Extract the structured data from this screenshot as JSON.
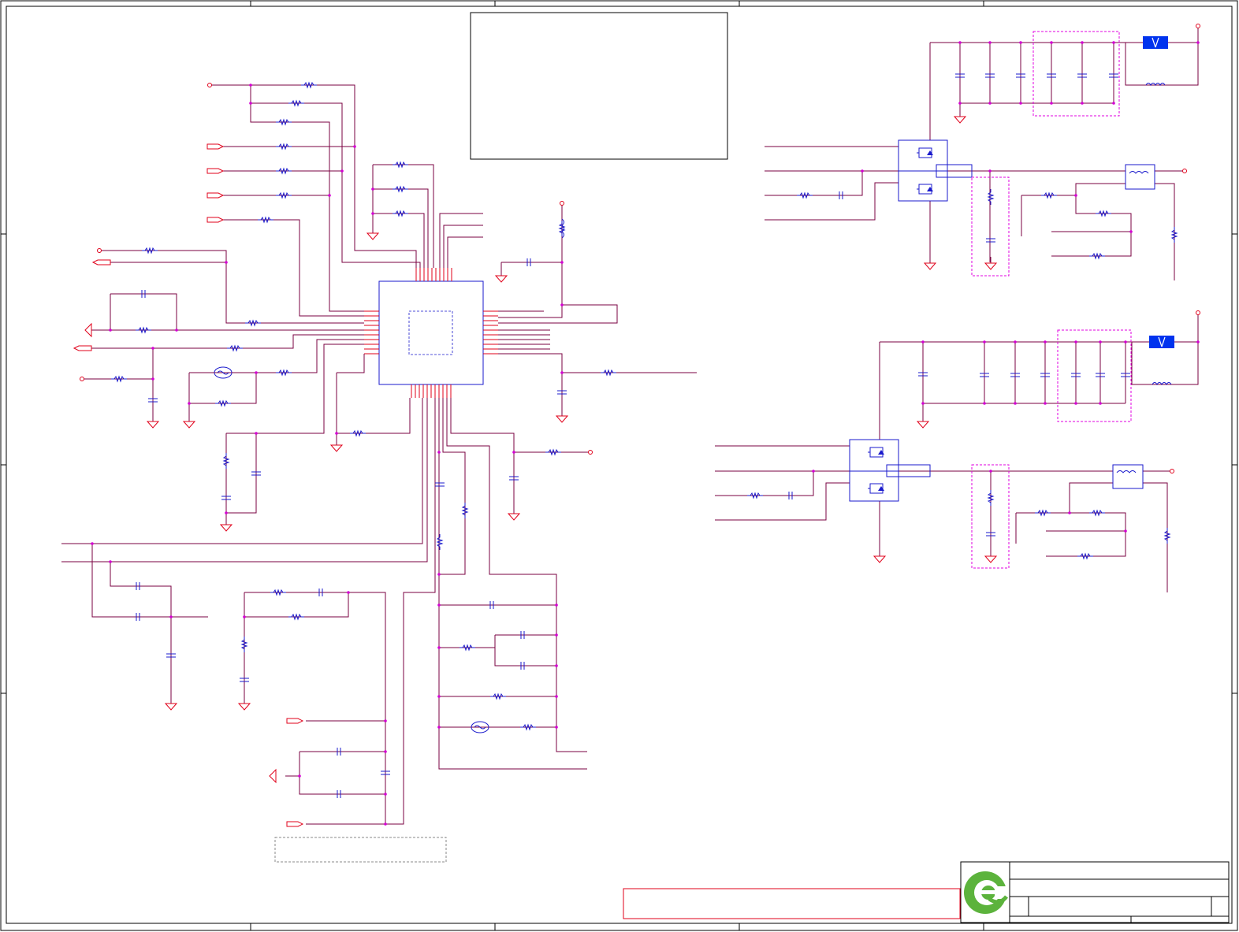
{
  "title_block": {
    "title": "",
    "sheet": "",
    "revision": "",
    "date": ""
  },
  "notes": {
    "main_note": "",
    "lower_note": "",
    "warning_note": ""
  },
  "colors": {
    "wire": "#7a0040",
    "net": "#e0001a",
    "component": "#1a1acc",
    "junction": "#d400d4",
    "highlight": "#e000e0",
    "mosfet_fill": "#0033ee",
    "logo_green": "#5cb33c",
    "border": "#000000"
  },
  "icons": {
    "logo": "company-logo-icon",
    "ground": "ground-icon",
    "resistor": "resistor-icon",
    "capacitor": "capacitor-icon",
    "inductor": "inductor-icon",
    "crystal": "crystal-icon",
    "mosfet": "mosfet-icon",
    "port": "port-icon",
    "power_pin": "power-pin-icon"
  }
}
